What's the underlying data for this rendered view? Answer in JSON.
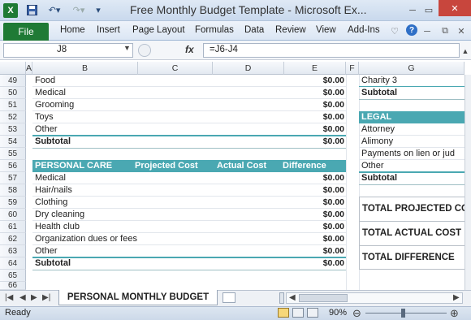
{
  "window": {
    "title": "Free Monthly Budget Template  -  Microsoft Ex..."
  },
  "ribbon": {
    "file": "File",
    "tabs": [
      "Home",
      "Insert",
      "Page Layout",
      "Formulas",
      "Data",
      "Review",
      "View",
      "Add-Ins"
    ]
  },
  "formula_bar": {
    "cell_ref": "J8",
    "fx": "fx",
    "formula": "=J6-J4"
  },
  "columns": [
    "A",
    "B",
    "C",
    "D",
    "E",
    "F",
    "G"
  ],
  "rows": [
    "49",
    "50",
    "51",
    "52",
    "53",
    "54",
    "55",
    "56",
    "57",
    "58",
    "59",
    "60",
    "61",
    "62",
    "63",
    "64",
    "65",
    "66"
  ],
  "pets": {
    "items": [
      {
        "label": "Food",
        "amount": "$0.00"
      },
      {
        "label": "Medical",
        "amount": "$0.00"
      },
      {
        "label": "Grooming",
        "amount": "$0.00"
      },
      {
        "label": "Toys",
        "amount": "$0.00"
      },
      {
        "label": "Other",
        "amount": "$0.00"
      }
    ],
    "subtotal_label": "Subtotal",
    "subtotal_amount": "$0.00"
  },
  "personal_care": {
    "header": "PERSONAL CARE",
    "col_projected": "Projected Cost",
    "col_actual": "Actual Cost",
    "col_difference": "Difference",
    "items": [
      {
        "label": "Medical",
        "amount": "$0.00"
      },
      {
        "label": "Hair/nails",
        "amount": "$0.00"
      },
      {
        "label": "Clothing",
        "amount": "$0.00"
      },
      {
        "label": "Dry cleaning",
        "amount": "$0.00"
      },
      {
        "label": "Health club",
        "amount": "$0.00"
      },
      {
        "label": "Organization dues or fees",
        "amount": "$0.00"
      },
      {
        "label": "Other",
        "amount": "$0.00"
      }
    ],
    "subtotal_label": "Subtotal",
    "subtotal_amount": "$0.00"
  },
  "gifts": {
    "items": [
      "Charity 3"
    ],
    "subtotal_label": "Subtotal"
  },
  "legal": {
    "header": "LEGAL",
    "items": [
      "Attorney",
      "Alimony",
      "Payments on lien or jud",
      "Other"
    ],
    "subtotal_label": "Subtotal"
  },
  "totals": {
    "projected": "TOTAL PROJECTED CO",
    "actual": "TOTAL ACTUAL COST",
    "difference": "TOTAL DIFFERENCE"
  },
  "sheet_tab": "PERSONAL MONTHLY BUDGET",
  "status": {
    "ready": "Ready",
    "zoom": "90%"
  },
  "colors": {
    "accent_teal": "#4aa8b2",
    "excel_green": "#1f7a35"
  }
}
